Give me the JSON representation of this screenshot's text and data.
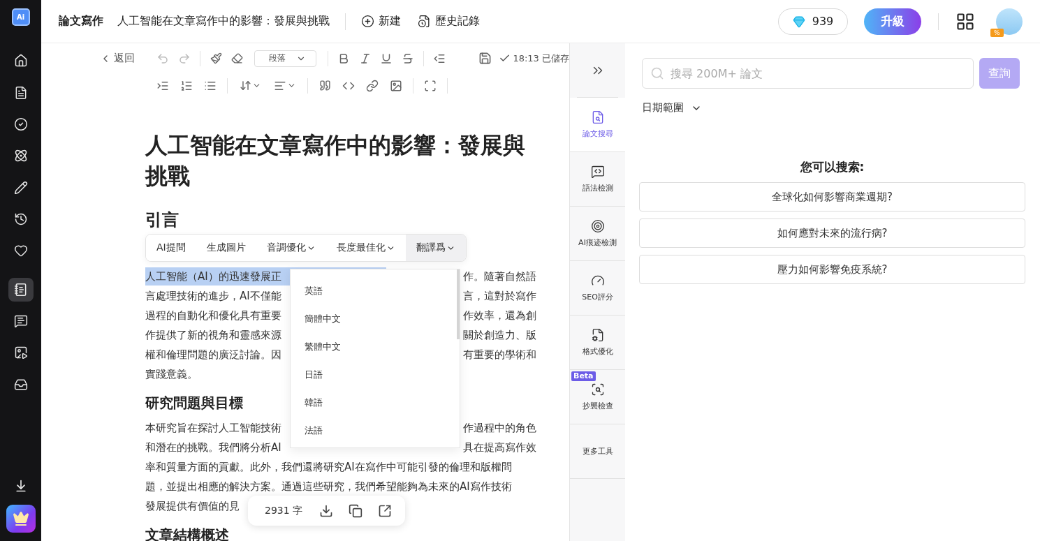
{
  "sidebar": {
    "logo": "Ai",
    "top_items": [
      {
        "selected": false
      },
      {
        "selected": false
      },
      {
        "selected": false
      },
      {
        "selected": false
      },
      {
        "selected": false
      },
      {
        "selected": false
      },
      {
        "selected": false
      }
    ],
    "bottom_items": [
      {
        "selected": true
      },
      {
        "selected": false
      },
      {
        "selected": false
      },
      {
        "selected": false
      }
    ]
  },
  "header": {
    "section": "論文寫作",
    "doc_title": "人工智能在文章寫作中的影響：發展與挑戰",
    "actions": [
      "新建",
      "歷史記錄"
    ],
    "credits": "939",
    "upgrade": "升級",
    "avatar_badge": "%"
  },
  "toolbar": {
    "back": "返回",
    "block_style": "段落",
    "saved": "18:13 已儲存"
  },
  "document": {
    "title": "人工智能在文章寫作中的影響：發展與挑戰",
    "blocks": [
      {
        "kind": "heading",
        "text": "引言"
      },
      {
        "kind": "paragraph",
        "lines": [
          {
            "left": "人工智能（AI）的迅速發展正",
            "right": "作。隨著自然語",
            "highlighted": true
          },
          {
            "left": "言處理技術的進步，AI不僅能",
            "right": "言，這對於寫作",
            "highlighted": false
          },
          {
            "left": "過程的自動化和優化具有重要",
            "right": "作效率，還為創",
            "highlighted": false
          },
          {
            "left": "作提供了新的視角和靈感來源",
            "right": "關於創造力、版",
            "highlighted": false
          },
          {
            "left": "權和倫理問題的廣泛討論。因",
            "right": "有重要的學術和",
            "highlighted": false
          },
          {
            "left": "實踐意義。",
            "highlighted": false
          }
        ]
      },
      {
        "kind": "subheading",
        "text": "研究問題與目標"
      },
      {
        "kind": "paragraph",
        "lines": [
          {
            "left": "本研究旨在探討人工智能技術",
            "right": "作過程中的角色",
            "highlighted": false
          },
          {
            "left": "和潛在的挑戰。我們將分析AI",
            "right": "具在提高寫作效",
            "highlighted": false
          },
          {
            "left": "率和質量方面的貢獻。此外，我們還將研究AI在寫作中可能引發的倫理和版權問",
            "highlighted": false
          },
          {
            "left": "題，並提出相應的解決方案。通過這些研究，我們希望能夠為未來的AI寫作技術",
            "highlighted": false
          },
          {
            "left": "發展提供有價值的見",
            "highlighted": false
          }
        ]
      },
      {
        "kind": "subheading",
        "text": "文章結構概述"
      }
    ]
  },
  "ai_toolbar": {
    "items": [
      {
        "label": "AI提問",
        "has_menu": false,
        "selected": false
      },
      {
        "label": "生成圖片",
        "has_menu": false,
        "selected": false
      },
      {
        "label": "音調優化",
        "has_menu": true,
        "selected": false
      },
      {
        "label": "長度最佳化",
        "has_menu": true,
        "selected": false
      },
      {
        "label": "翻譯爲",
        "has_menu": true,
        "selected": true
      }
    ]
  },
  "translate_menu": {
    "items": [
      "英語",
      "簡體中文",
      "繁體中文",
      "日語",
      "韓語",
      "法語"
    ]
  },
  "word_count": "2931 字",
  "tool_rail": {
    "items": [
      {
        "label": "論文搜尋",
        "selected": true
      },
      {
        "label": "語法檢測",
        "selected": false
      },
      {
        "label": "AI痕迹檢測",
        "selected": false
      },
      {
        "label": "SEO評分",
        "selected": false
      },
      {
        "label": "格式優化",
        "selected": false
      },
      {
        "label": "抄襲檢查",
        "selected": false,
        "badge": "Beta"
      },
      {
        "label": "更多工具",
        "selected": false
      }
    ]
  },
  "search_panel": {
    "placeholder": "搜尋 200M+ 論文",
    "button": "查詢",
    "button_disabled": true,
    "date_filter": "日期範圍",
    "suggest_title": "您可以搜索:",
    "suggestions": [
      "全球化如何影響商業週期?",
      "如何應對未來的流行病?",
      "壓力如何影響免疫系統?"
    ]
  }
}
